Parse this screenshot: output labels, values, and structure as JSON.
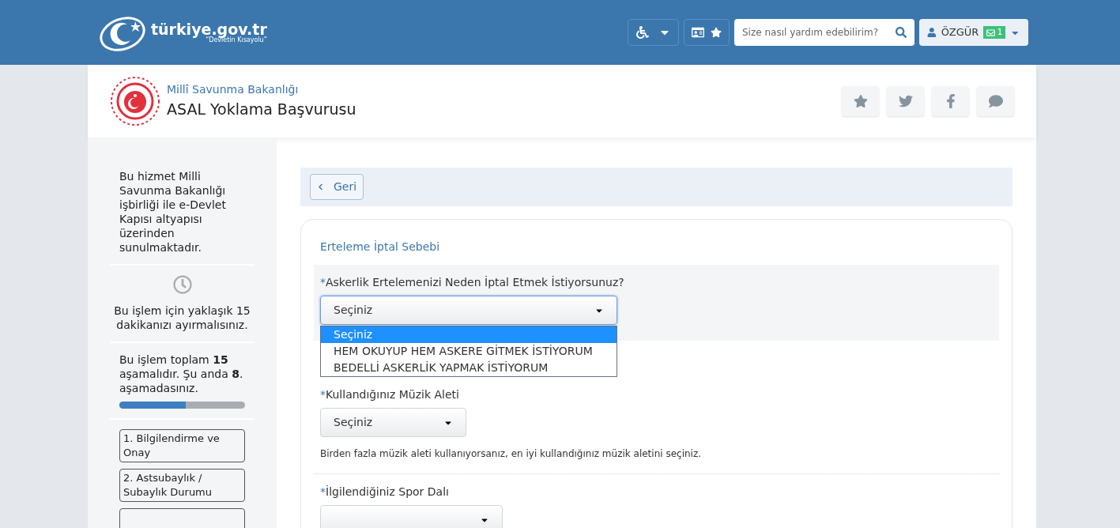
{
  "header": {
    "logo": "türkiye.gov.tr",
    "tagline": "“Devletin Kısayolu”",
    "search": {
      "placeholder": "Size nasıl yardım edebilirim?"
    },
    "user": {
      "name": "ÖZGÜR",
      "messages": "1"
    }
  },
  "service": {
    "ministry": "Millî Savunma Bakanlığı",
    "title": "ASAL Yoklama Başvurusu"
  },
  "sidebar": {
    "info": "Bu hizmet Milli Savunma Bakanlığı işbirliği ile e-Devlet Kapısı altyapısı üzerinden sunulmaktadır.",
    "time": "Bu işlem için yaklaşık 15 dakikanızı ayırmalısınız.",
    "progress_text": "Bu işlem toplam **15** aşamalıdır. Şu anda **8**. aşamadasınız.",
    "level": 0.53,
    "steps": [
      {
        "label": "1. Bilgilendirme ve Onay"
      },
      {
        "label": "2. Astsubaylık / Subaylık Durumu"
      }
    ]
  },
  "back_button": "Geri",
  "section_title": "Erteleme İptal Sebebi",
  "fields": [
    {
      "required_mark": "*",
      "label": "Askerlik Ertelemenizi Neden İptal Etmek İstiyorsunuz?",
      "value": "Seçiniz",
      "expanded": true,
      "options": [
        {
          "label": "Seçiniz",
          "selected": true
        },
        {
          "label": "HEM OKUYUP HEM ASKERE GİTMEK İSTİYORUM",
          "selected": false
        },
        {
          "label": "BEDELLİ ASKERLİK YAPMAK İSTİYORUM",
          "selected": false
        }
      ]
    },
    {
      "required_mark": "*",
      "label": "Kullandığınız Müzik Aleti",
      "value": "Seçiniz",
      "expanded": false,
      "hint": "Birden fazla müzik aleti kullanıyorsanız, en iyi kullandığınız müzik aletini seçiniz."
    },
    {
      "required_mark": "*",
      "label": "İlgilendiğiniz Spor Dalı"
    }
  ]
}
